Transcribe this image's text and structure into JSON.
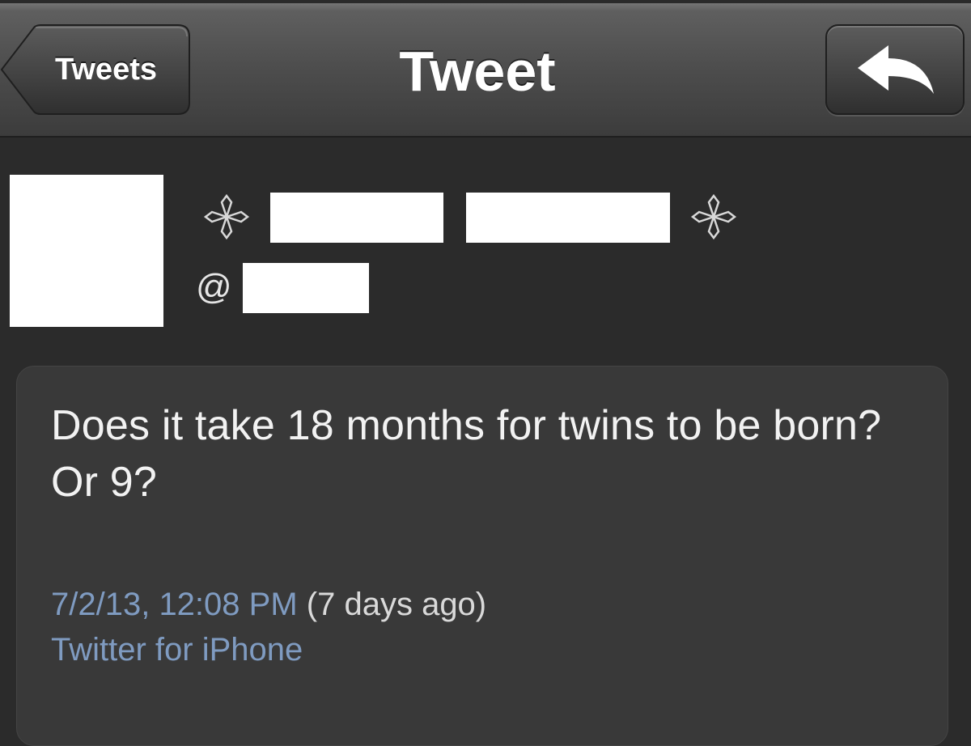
{
  "navbar": {
    "back_label": "Tweets",
    "title": "Tweet",
    "reply_icon": "reply-arrow-icon"
  },
  "profile": {
    "at_prefix": "@",
    "decoration_icon": "flower-icon"
  },
  "tweet": {
    "text": "Does it take 18 months for twins to be born? Or 9?",
    "timestamp": "7/2/13, 12:08 PM",
    "relative_time": "(7 days ago)",
    "source": "Twitter for iPhone"
  },
  "colors": {
    "background": "#2b2b2b",
    "card": "#393939",
    "link": "#7f9bc1",
    "text": "#f2f2f2"
  }
}
